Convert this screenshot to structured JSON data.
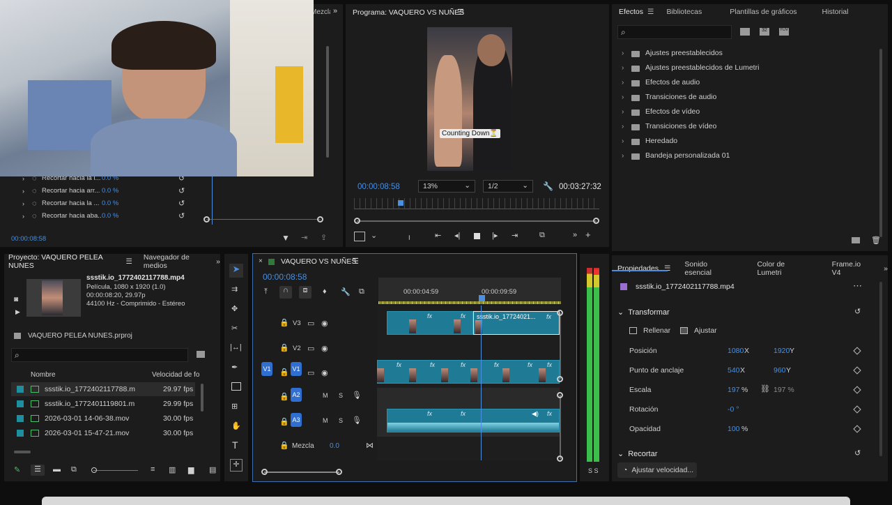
{
  "effect_controls": {
    "rows": [
      {
        "label": "Recortar hacia la i...",
        "value": "0.0 %"
      },
      {
        "label": "Recortar hacia arr...",
        "value": "0.0 %"
      },
      {
        "label": "Recortar hacia la ...",
        "value": "0.0 %"
      },
      {
        "label": "Recortar hacia aba...",
        "value": "0.0 %"
      }
    ],
    "timecode": "00:00:08:58",
    "tab_partial": "Mezcla"
  },
  "program": {
    "title": "Programa: VAQUERO VS NUÑES",
    "timecode": "00:00:08:58",
    "zoom": "13%",
    "resolution": "1/2",
    "duration": "00:03:27:32",
    "caption": "Counting Down⏳",
    "playhead_fraction": 0.19
  },
  "effects_panel": {
    "tabs": [
      "Efectos",
      "Bibliotecas",
      "Plantillas de gráficos",
      "Historial"
    ],
    "items": [
      "Ajustes preestablecidos",
      "Ajustes preestablecidos de Lumetri",
      "Efectos de audio",
      "Transiciones de audio",
      "Efectos de vídeo",
      "Transiciones de vídeo",
      "Heredado",
      "Bandeja personalizada 01"
    ]
  },
  "project": {
    "tabs": [
      "Proyecto: VAQUERO PELEA NUNES",
      "Navegador de medios"
    ],
    "clip_name": "ssstik.io_1772402117788.mp4",
    "clip_info": [
      "Película, 1080 x 1920 (1.0)",
      "00:00:08:20, 29.97p",
      "44100 Hz - Comprimido - Estéreo"
    ],
    "project_file": "VAQUERO PELEA NUNES.prproj",
    "col_name": "Nombre",
    "col_fps": "Velocidad de fo",
    "files": [
      {
        "name": "ssstik.io_1772402117788.m",
        "fps": "29.97 fps"
      },
      {
        "name": "ssstik.io_1772401119801.m",
        "fps": "29.99 fps"
      },
      {
        "name": "2026-03-01 14-06-38.mov",
        "fps": "30.00 fps"
      },
      {
        "name": "2026-03-01 15-47-21.mov",
        "fps": "30.00 fps"
      }
    ]
  },
  "timeline": {
    "title": "VAQUERO VS NUÑES",
    "timecode": "00:00:08:58",
    "ruler": [
      "00:00:04:59",
      "00:00:09:59"
    ],
    "tracks": {
      "v3": "V3",
      "v2": "V2",
      "v1": "V1",
      "a2": "A2",
      "a3": "A3",
      "src_v1": "V1"
    },
    "clip_label": "ssstik.io_17724021...",
    "mix_label": "Mezcla",
    "mix_value": "0.0",
    "meter_db": "S S",
    "m": "M",
    "s": "S"
  },
  "properties": {
    "tabs": [
      "Propiedades",
      "Sonido esencial",
      "Color de Lumetri",
      "Frame.io V4"
    ],
    "file": "ssstik.io_1772402117788.mp4",
    "section": "Transformar",
    "fill": "Rellenar",
    "fit": "Ajustar",
    "position": {
      "label": "Posición",
      "x": "1080",
      "y": "1920"
    },
    "anchor": {
      "label": "Punto de anclaje",
      "x": "540",
      "y": "960"
    },
    "scale": {
      "label": "Escala",
      "value": "197",
      "linked": "197 %"
    },
    "rotation": {
      "label": "Rotación",
      "value": "-0 °"
    },
    "opacity": {
      "label": "Opacidad",
      "value": "100"
    },
    "crop": "Recortar",
    "speed_button": "Ajustar velocidad...",
    "x_lbl": "X",
    "y_lbl": "Y",
    "pct": "%"
  }
}
